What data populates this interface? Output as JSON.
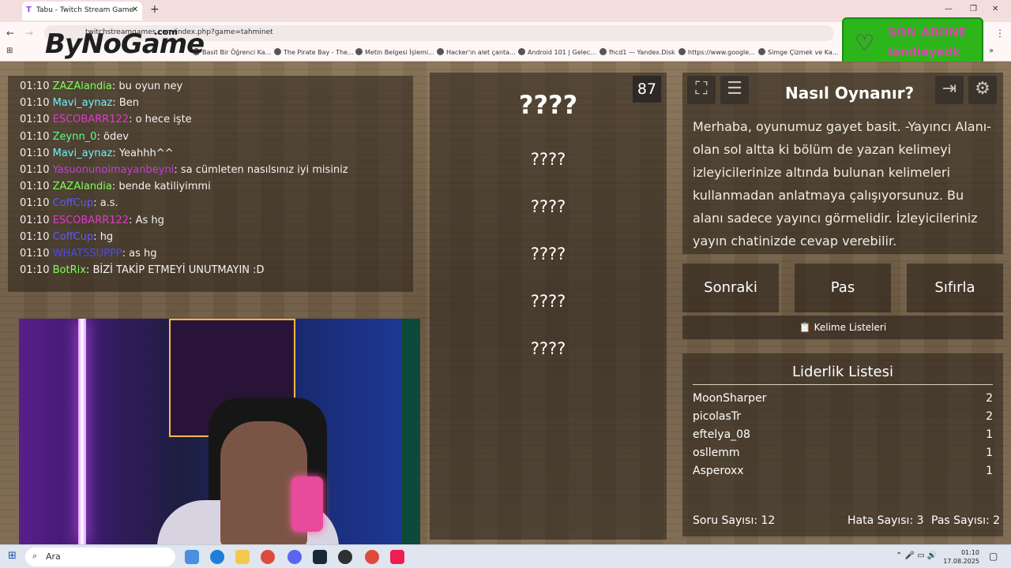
{
  "browser": {
    "tab_title": "Tabu - Twitch Stream Game",
    "url": "twitchstreamgames.com/index.php?game=tahminet",
    "bookmarks": [
      "Basit Bir Öğrenci Ka...",
      "The Pirate Bay - The...",
      "Metin Belgesi İşlemi...",
      "Hacker'ın alet çanta...",
      "Android 101 | Gelec...",
      "fhcd1 — Yandex.Disk",
      "https://www.google...",
      "Simge Çizmek ve Ka..."
    ]
  },
  "overlay": {
    "logo": "ByNoGame",
    "logo_sub": ".com",
    "sub_title": "SON ABONE",
    "sub_name": "landiayedk"
  },
  "chat": [
    {
      "time": "01:10",
      "user": "ZAZAlandia",
      "color": "#7dff5a",
      "msg": "bu oyun ney"
    },
    {
      "time": "01:10",
      "user": "Mavi_aynaz",
      "color": "#6ff0ff",
      "msg": "Ben"
    },
    {
      "time": "01:10",
      "user": "ESCOBARR122",
      "color": "#e03ac9",
      "msg": "o hece işte"
    },
    {
      "time": "01:10",
      "user": "Zeynn_0",
      "color": "#5dff8a",
      "msg": "ödev"
    },
    {
      "time": "01:10",
      "user": "Mavi_aynaz",
      "color": "#6ff0ff",
      "msg": "Yeahhh^^"
    },
    {
      "time": "01:10",
      "user": "Yasuonunolmayanbeyni",
      "color": "#c23fd8",
      "msg": "sa cümleten nasılsınız iyi misiniz"
    },
    {
      "time": "01:10",
      "user": "ZAZAlandia",
      "color": "#7dff5a",
      "msg": "bende katiliyimmi"
    },
    {
      "time": "01:10",
      "user": "CoffCup",
      "color": "#5b5bff",
      "msg": "a.s."
    },
    {
      "time": "01:10",
      "user": "ESCOBARR122",
      "color": "#e03ac9",
      "msg": "As hg"
    },
    {
      "time": "01:10",
      "user": "CoffCup",
      "color": "#5b5bff",
      "msg": "hg"
    },
    {
      "time": "01:10",
      "user": "WHATSSUPPP",
      "color": "#4a4ae8",
      "msg": "as hg"
    },
    {
      "time": "01:10",
      "user": "BotRix",
      "color": "#7dff5a",
      "msg": "BİZİ TAKİP ETMEYİ UNUTMAYIN :D"
    }
  ],
  "game": {
    "timer": "87",
    "main_word": "????",
    "taboo_words": [
      "????",
      "????",
      "????",
      "????",
      "????"
    ]
  },
  "info": {
    "title": "Nasıl Oynanır?",
    "text": "Merhaba, oyunumuz gayet basit. -Yayıncı Alanı- olan sol altta ki bölüm de yazan kelimeyi izleyicilerinize altında bulunan kelimeleri kullanmadan anlatmaya çalışıyorsunuz. Bu alanı sadece yayıncı görmelidir. İzleyicileriniz yayın chatinizde cevap verebilir."
  },
  "controls": {
    "next": "Sonraki",
    "pass": "Pas",
    "reset": "Sıfırla",
    "word_lists": "Kelime Listeleri"
  },
  "leaderboard": {
    "title": "Liderlik Listesi",
    "rows": [
      {
        "name": "MoonSharper",
        "score": "2"
      },
      {
        "name": "picolasTr",
        "score": "2"
      },
      {
        "name": "eftelya_08",
        "score": "1"
      },
      {
        "name": "osllemm",
        "score": "1"
      },
      {
        "name": "Asperoxx",
        "score": "1"
      }
    ],
    "questions": "Soru Sayısı: 12",
    "errors": "Hata Sayısı: 3",
    "passes": "Pas Sayısı: 2"
  },
  "taskbar": {
    "search": "Ara",
    "time": "01:10",
    "date": "17.08.2025"
  }
}
